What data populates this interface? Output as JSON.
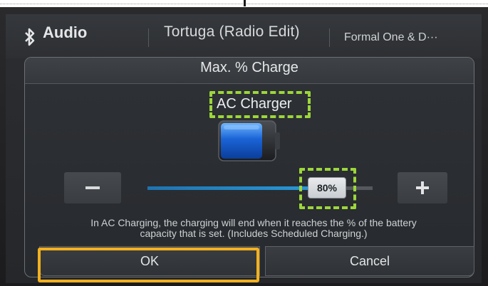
{
  "statusbar": {
    "source_label": "Audio",
    "source_icon": "bluetooth-icon",
    "track_title": "Tortuga (Radio Edit)",
    "artist": "Formal One & D···"
  },
  "dialog": {
    "title": "Max. % Charge",
    "charger_label": "AC Charger",
    "battery_icon": "battery-icon",
    "slider": {
      "value_label": "80%",
      "value": 80
    },
    "minus_icon": "minus-icon",
    "plus_icon": "plus-icon",
    "info_line1": "In AC Charging, the charging will end when it reaches the % of the battery",
    "info_line2": "capacity that is set. (Includes Scheduled Charging.)",
    "ok_label": "OK",
    "cancel_label": "Cancel"
  },
  "colors": {
    "highlight_green": "#9cd63a",
    "highlight_orange": "#f3b11e",
    "slider_fill": "#2a9ad8"
  }
}
